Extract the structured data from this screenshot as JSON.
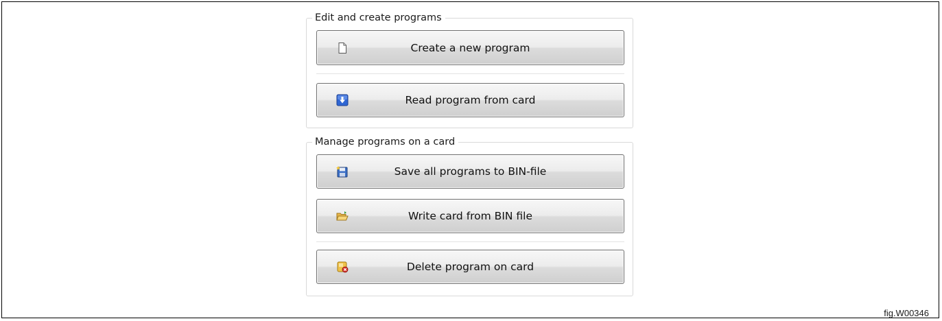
{
  "edit_group": {
    "legend": "Edit and create programs",
    "buttons": [
      {
        "label": "Create a new program",
        "icon": "new-document-icon"
      },
      {
        "label": "Read program from card",
        "icon": "download-arrow-icon"
      }
    ]
  },
  "manage_group": {
    "legend": "Manage programs on a card",
    "buttons": [
      {
        "label": "Save all programs to BIN-file",
        "icon": "save-disk-icon"
      },
      {
        "label": "Write card from BIN file",
        "icon": "open-folder-icon"
      },
      {
        "label": "Delete program on card",
        "icon": "delete-card-icon"
      }
    ]
  },
  "figure_label": "fig.W00346",
  "colors": {
    "button_border": "#707070",
    "group_border": "#d9d9d9",
    "arrow_icon_blue": "#2f66d3"
  }
}
